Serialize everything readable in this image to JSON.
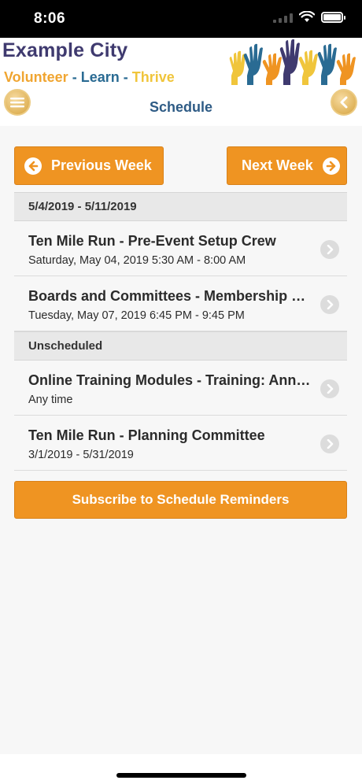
{
  "status_bar": {
    "time": "8:06"
  },
  "header": {
    "brand": "Example City",
    "tagline": {
      "volunteer": "Volunteer",
      "dash1": "-",
      "learn": "Learn",
      "dash2": "-",
      "thrive": "Thrive"
    },
    "title": "Schedule",
    "menu_icon": "hamburger-icon",
    "back_icon": "chevron-left-icon"
  },
  "week_nav": {
    "previous_label": "Previous Week",
    "next_label": "Next Week"
  },
  "sections": [
    {
      "header": "5/4/2019 - 5/11/2019",
      "items": [
        {
          "title": "Ten Mile Run - Pre-Event Setup Crew",
          "subtitle": "Saturday, May 04, 2019 5:30 AM - 8:00 AM"
        },
        {
          "title": "Boards and Committees - Membership Committee",
          "subtitle": "Tuesday, May 07, 2019 6:45 PM - 9:45 PM"
        }
      ]
    },
    {
      "header": "Unscheduled",
      "items": [
        {
          "title": "Online Training Modules - Training: Annual",
          "subtitle": "Any time"
        },
        {
          "title": "Ten Mile Run - Planning Committee",
          "subtitle": "3/1/2019 - 5/31/2019"
        }
      ]
    }
  ],
  "subscribe_label": "Subscribe to Schedule Reminders",
  "colors": {
    "accent": "#ef9422",
    "brand": "#3f3a6f",
    "title": "#2e5b85"
  }
}
